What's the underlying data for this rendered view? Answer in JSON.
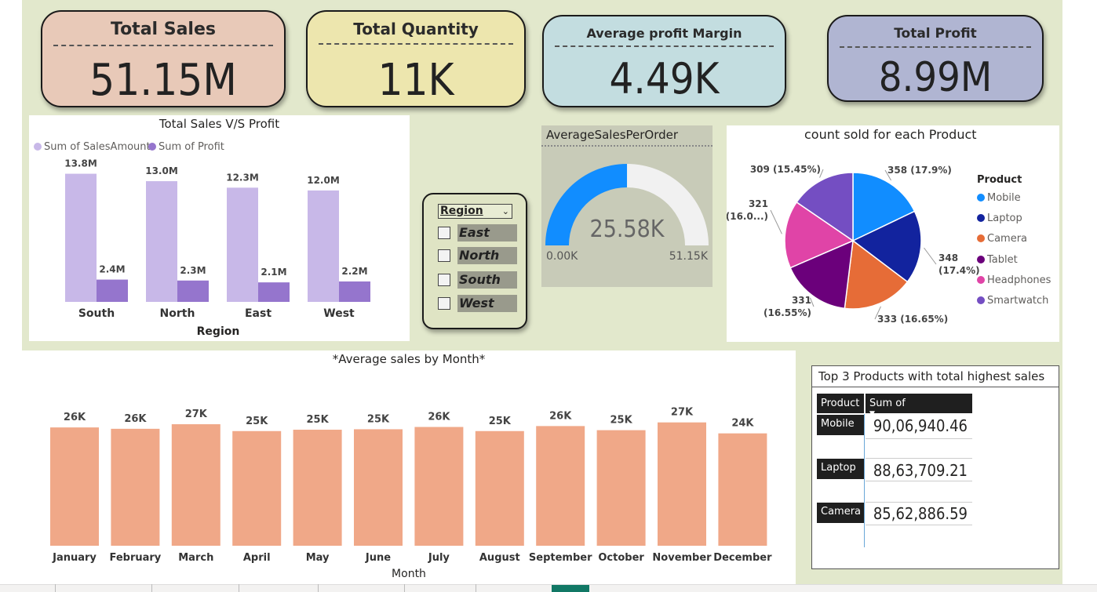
{
  "kpis": {
    "total_sales": {
      "label": "Total Sales",
      "value": "51.15M",
      "color": "#e8c9b8"
    },
    "total_quantity": {
      "label": "Total Quantity",
      "value": "11K",
      "color": "#ede6ae"
    },
    "avg_profit_margin": {
      "label": "Average profit Margin",
      "value": "4.49K",
      "color": "#c3dde0"
    },
    "total_profit": {
      "label": "Total Profit",
      "value": "8.99M",
      "color": "#b0b5d2"
    }
  },
  "slicer": {
    "header": "Region",
    "options": [
      "East",
      "North",
      "South",
      "West"
    ]
  },
  "gauge": {
    "title": "AverageSalesPerOrder",
    "value_label": "25.58K",
    "min_label": "0.00K",
    "max_label": "51.15K",
    "value": 25.58,
    "min": 0,
    "max": 51.15,
    "fill_color": "#118dff",
    "track_color": "#f1f1f1"
  },
  "top_products": {
    "title": "Top 3 Products with total highest sales",
    "headers": [
      "Product",
      "Sum of SalesAmount"
    ],
    "rows": [
      {
        "product": "Mobile",
        "amount": "90,06,940.46"
      },
      {
        "product": "Laptop",
        "amount": "88,63,709.21"
      },
      {
        "product": "Camera",
        "amount": "85,62,886.59"
      }
    ]
  },
  "chart_data": [
    {
      "type": "bar",
      "title": "Total Sales V/S Profit",
      "xlabel": "Region",
      "ylabel": "",
      "categories": [
        "South",
        "North",
        "East",
        "West"
      ],
      "series": [
        {
          "name": "Sum of SalesAmount",
          "values": [
            13.8,
            13.0,
            12.3,
            12.0
          ],
          "labels": [
            "13.8M",
            "13.0M",
            "12.3M",
            "12.0M"
          ],
          "color": "#c8b8e8"
        },
        {
          "name": "Sum of Profit",
          "values": [
            2.4,
            2.3,
            2.1,
            2.2
          ],
          "labels": [
            "2.4M",
            "2.3M",
            "2.1M",
            "2.2M"
          ],
          "color": "#9575cd"
        }
      ],
      "ylim": [
        0,
        15
      ],
      "legend": "top-left",
      "grid": false
    },
    {
      "type": "pie",
      "title": "count sold for each Product",
      "legend_title": "Product",
      "legend": "right",
      "slices": [
        {
          "name": "Mobile",
          "value": 358,
          "label": "358 (17.9%)",
          "color": "#118dff"
        },
        {
          "name": "Laptop",
          "value": 348,
          "label": "348 (17.4%)",
          "color": "#12239e"
        },
        {
          "name": "Camera",
          "value": 333,
          "label": "333 (16.65%)",
          "color": "#e66c37"
        },
        {
          "name": "Tablet",
          "value": 331,
          "label": "331 (16.55%)",
          "color": "#6b007b"
        },
        {
          "name": "Headphones",
          "value": 321,
          "label": "321 (16.0...)",
          "color": "#e044a7"
        },
        {
          "name": "Smartwatch",
          "value": 309,
          "label": "309 (15.45%)",
          "color": "#744ec2"
        }
      ]
    },
    {
      "type": "bar",
      "title": "*Average sales by Month*",
      "xlabel": "Month",
      "ylabel": "",
      "categories": [
        "January",
        "February",
        "March",
        "April",
        "May",
        "June",
        "July",
        "August",
        "September",
        "October",
        "November",
        "December"
      ],
      "values": [
        26,
        26,
        27,
        25,
        25,
        25,
        26,
        25,
        26,
        25,
        27,
        24
      ],
      "labels": [
        "26K",
        "26K",
        "27K",
        "25K",
        "25K",
        "25K",
        "26K",
        "25K",
        "26K",
        "25K",
        "27K",
        "24K"
      ],
      "value_precision": [
        25.9,
        25.6,
        26.6,
        25.1,
        25.4,
        25.5,
        26.0,
        25.1,
        26.2,
        25.3,
        27.0,
        24.6
      ],
      "color": "#f0a888",
      "grid": false
    }
  ]
}
